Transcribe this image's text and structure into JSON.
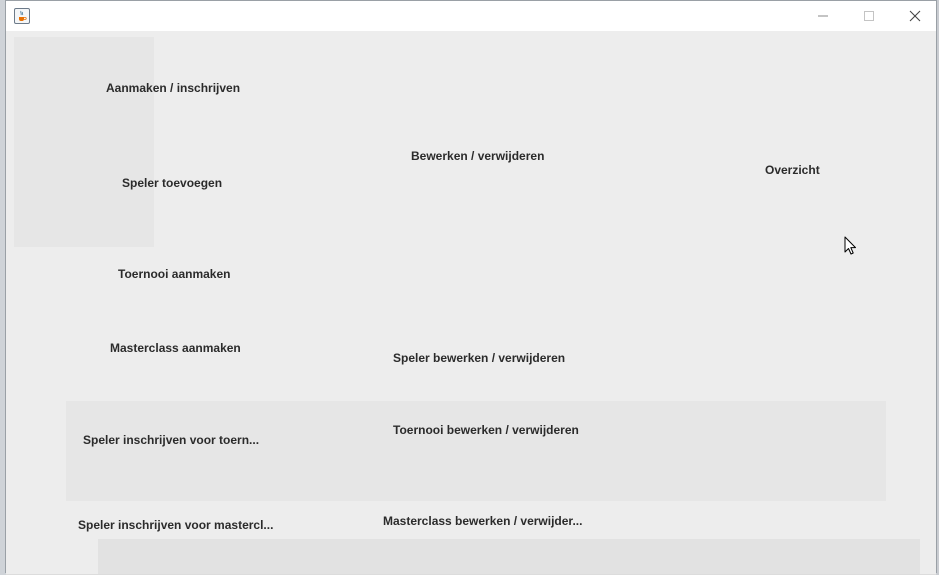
{
  "window": {
    "title": "",
    "app_icon": "java-coffee-icon",
    "controls": [
      "minimize-icon",
      "maximize-icon",
      "close-icon"
    ]
  },
  "column_left": {
    "heading": "Aanmaken / inschrijven",
    "items": [
      "Speler toevoegen",
      "Toernooi aanmaken",
      "Masterclass aanmaken",
      "Speler inschrijven voor toern...",
      "Speler inschrijven voor mastercl..."
    ]
  },
  "column_middle": {
    "heading": "Bewerken / verwijderen",
    "items": [
      "Speler bewerken / verwijderen",
      "Toernooi bewerken / verwijderen",
      "Masterclass bewerken / verwijder..."
    ]
  },
  "column_right": {
    "heading": "Overzicht"
  },
  "colors": {
    "window_bg": "#eeeeee",
    "titlebar_bg": "#ffffff",
    "label_text": "#2b2b2b"
  },
  "pointer": "arrow-cursor-icon"
}
